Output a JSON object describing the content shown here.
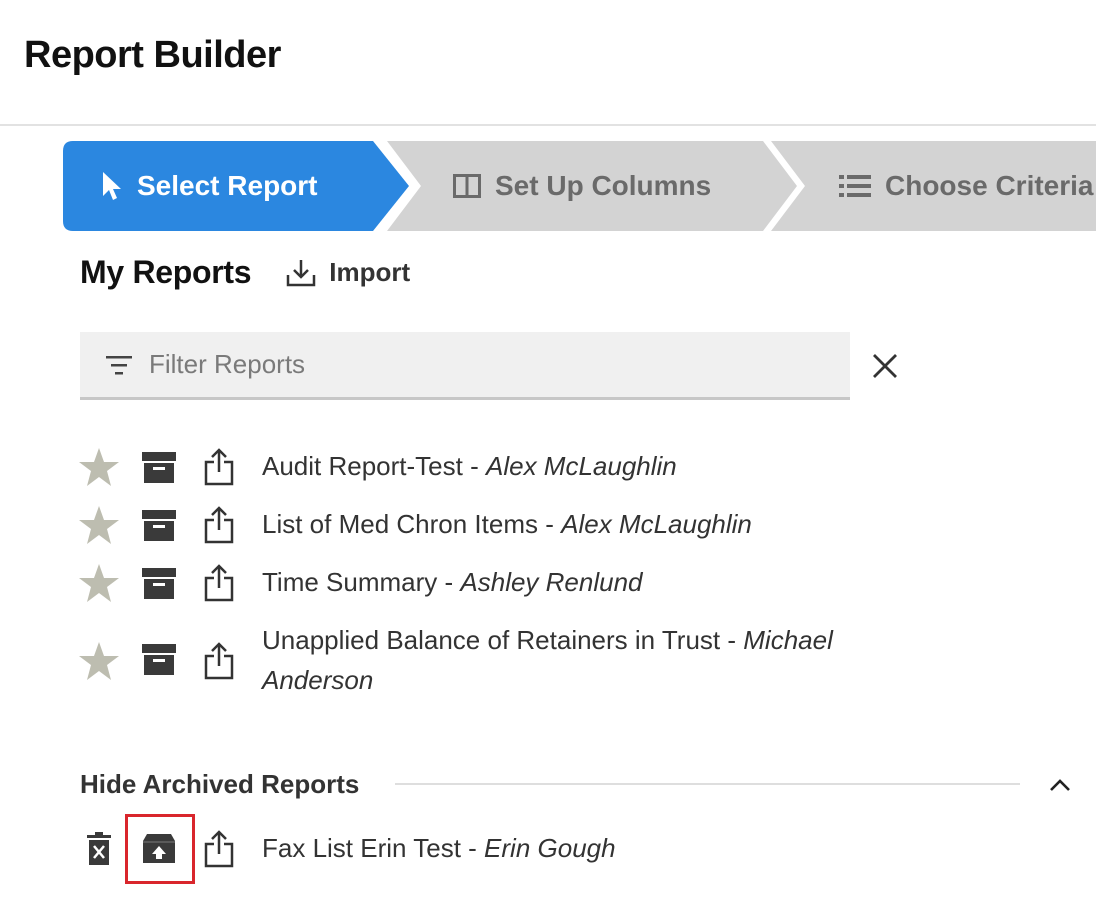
{
  "app": {
    "title": "Report Builder"
  },
  "wizard": {
    "steps": [
      {
        "label": "Select Report",
        "icon": "cursor-arrow-icon",
        "active": true
      },
      {
        "label": "Set Up Columns",
        "icon": "columns-icon",
        "active": false
      },
      {
        "label": "Choose Criteria",
        "icon": "list-icon",
        "active": false
      }
    ],
    "active_color": "#2b87e0",
    "inactive_color": "#d3d3d3"
  },
  "my_reports": {
    "title": "My Reports",
    "import_label": "Import"
  },
  "filter": {
    "placeholder": "Filter Reports",
    "value": ""
  },
  "reports": [
    {
      "name": "Audit Report-Test",
      "separator": " - ",
      "author": "Alex McLaughlin"
    },
    {
      "name": "List of Med Chron Items",
      "separator": " - ",
      "author": "Alex McLaughlin"
    },
    {
      "name": "Time Summary",
      "separator": " - ",
      "author": "Ashley Renlund"
    },
    {
      "name": "Unapplied Balance of Retainers in Trust",
      "separator": " - ",
      "author": "Michael Anderson"
    }
  ],
  "archived": {
    "toggle_label": "Hide Archived Reports",
    "items": [
      {
        "name": "Fax List Erin Test",
        "separator": " - ",
        "author": "Erin Gough"
      }
    ]
  },
  "colors": {
    "star": "#bdbdb0",
    "icon_dark": "#3a3a3a",
    "highlight": "#d9262c"
  }
}
